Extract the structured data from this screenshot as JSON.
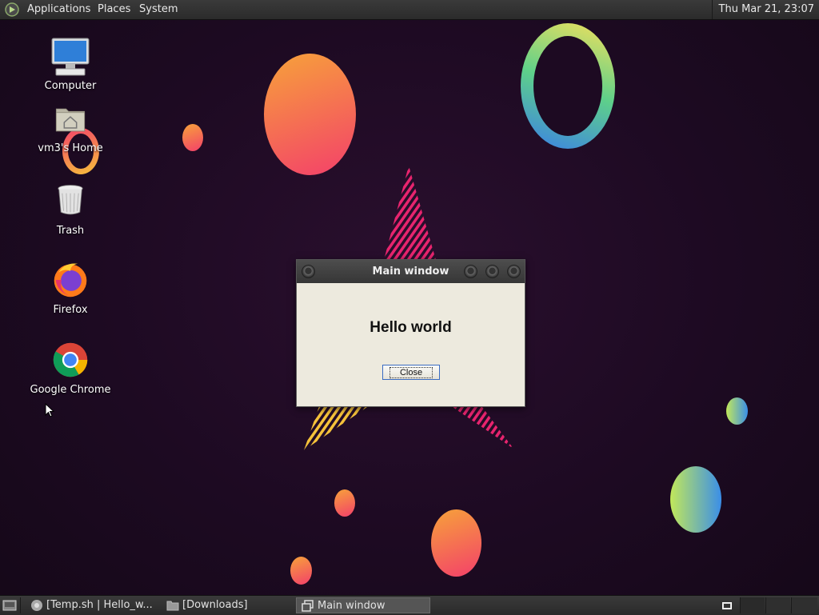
{
  "top_panel": {
    "menus": [
      "Applications",
      "Places",
      "System"
    ],
    "clock": "Thu Mar 21, 23:07"
  },
  "desktop": {
    "icons": [
      {
        "label": "Computer",
        "icon": "computer-icon"
      },
      {
        "label": "vm3's Home",
        "icon": "home-folder-icon"
      },
      {
        "label": "Trash",
        "icon": "trash-icon"
      },
      {
        "label": "Firefox",
        "icon": "firefox-icon"
      },
      {
        "label": "Google Chrome",
        "icon": "chrome-icon"
      }
    ]
  },
  "dialog": {
    "title": "Main window",
    "message": "Hello world",
    "close_label": "Close"
  },
  "taskbar": {
    "tasks": [
      {
        "label": "[Temp.sh | Hello_w...",
        "icon": "chrome-icon",
        "active": false
      },
      {
        "label": "[Downloads]",
        "icon": "folder-icon",
        "active": false
      },
      {
        "label": "Main window",
        "icon": "window-icon",
        "active": true
      }
    ]
  },
  "colors": {
    "background": "#1d0a22",
    "dialog_bg": "#edeade",
    "panel_bg": "#2b2b2b"
  }
}
